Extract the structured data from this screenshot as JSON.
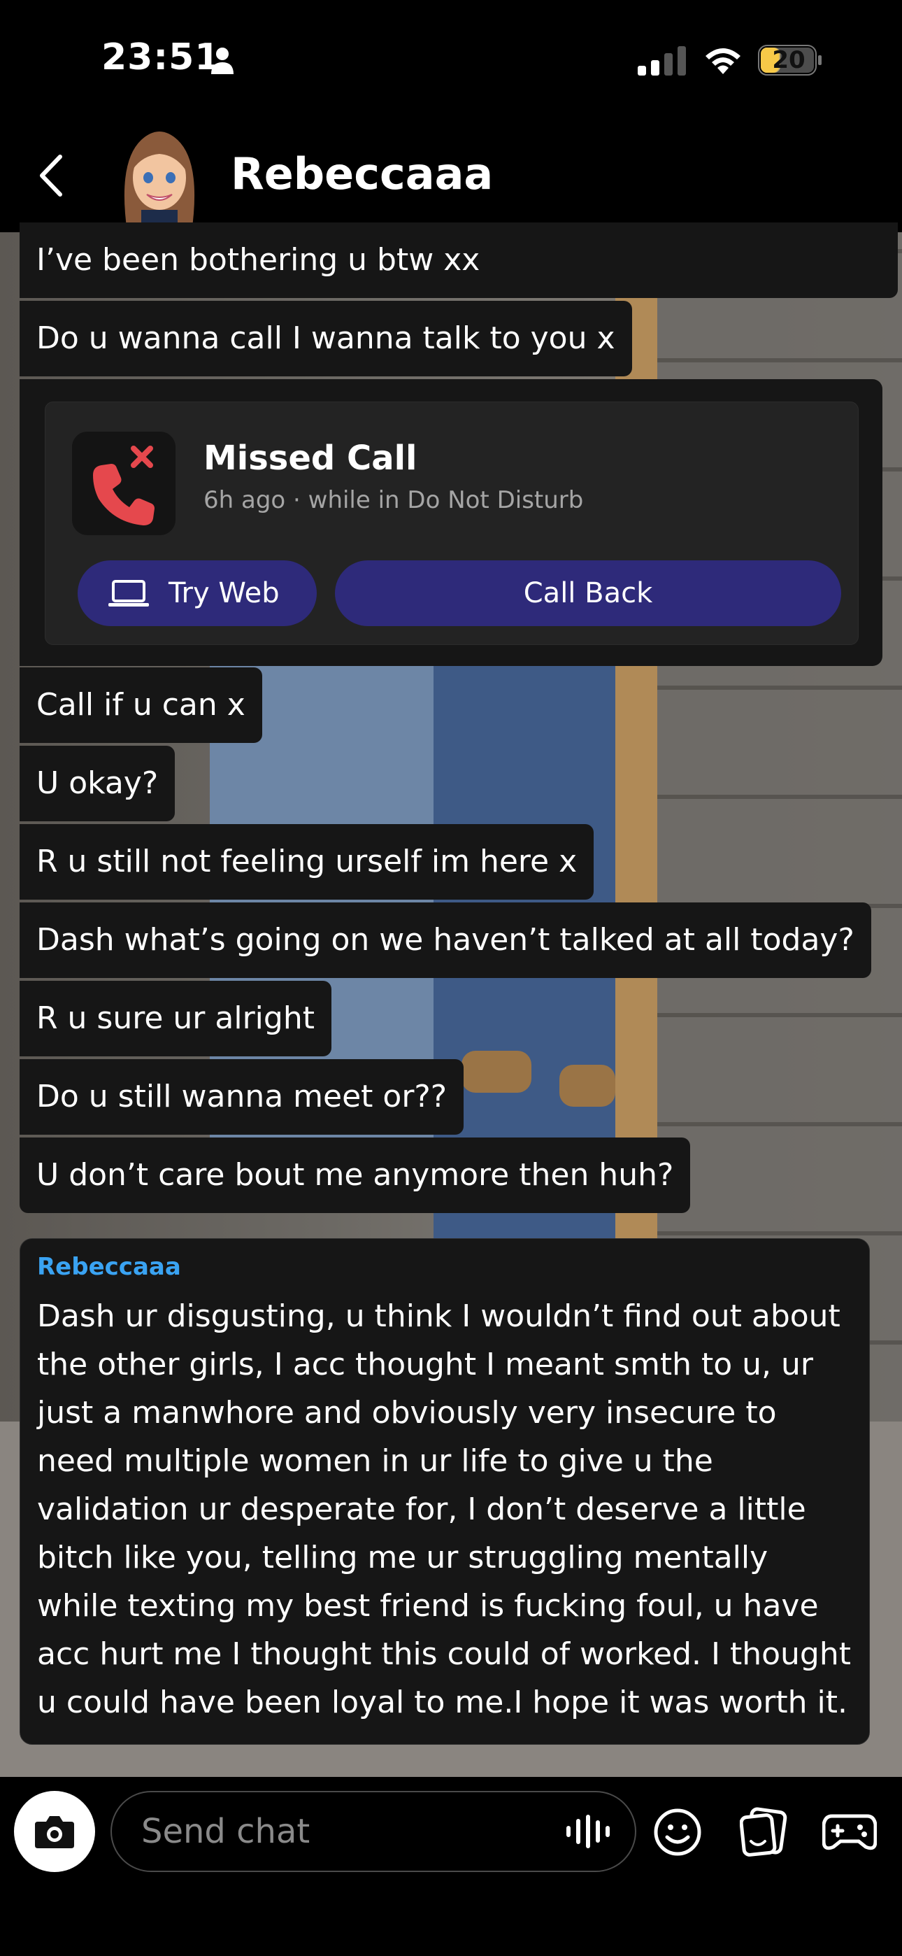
{
  "status_bar": {
    "time": "23:51",
    "battery": "20"
  },
  "header": {
    "contact_name": "Rebeccaaa"
  },
  "messages": {
    "m1": "I’ve been bothering u btw xx",
    "m2": "Do u wanna call I wanna talk to you x",
    "m3": "Call if u can x",
    "m4": "U okay?",
    "m5": "R u still not feeling urself im here x",
    "m6": "Dash what’s going on we haven’t talked at all today?",
    "m7": "R u sure ur alright",
    "m8": "Do u still wanna meet or??",
    "m9": "U don’t care bout me anymore then huh?"
  },
  "missed_call": {
    "title": "Missed Call",
    "subtitle": "6h ago · while in Do Not Disturb",
    "try_web_label": "Try Web",
    "call_back_label": "Call Back"
  },
  "reply": {
    "sender": "Rebeccaaa",
    "text": "Dash ur disgusting, u think I wouldn’t find out about the other girls, I acc thought I meant smth to u, ur just a manwhore and obviously very insecure to need multiple women in ur life to give u the validation ur desperate for, I don’t deserve a little bitch like you, telling me ur struggling mentally while texting my best friend is fucking foul, u have acc hurt me I thought this could of worked. I thought u could have been loyal to me.I hope it was worth it."
  },
  "composer": {
    "placeholder": "Send chat"
  },
  "colors": {
    "accent_button": "#2e2a7a",
    "missed_call_red": "#e5484d",
    "sender_blue": "#3aa3f2",
    "battery_yellow": "#f7c948"
  }
}
